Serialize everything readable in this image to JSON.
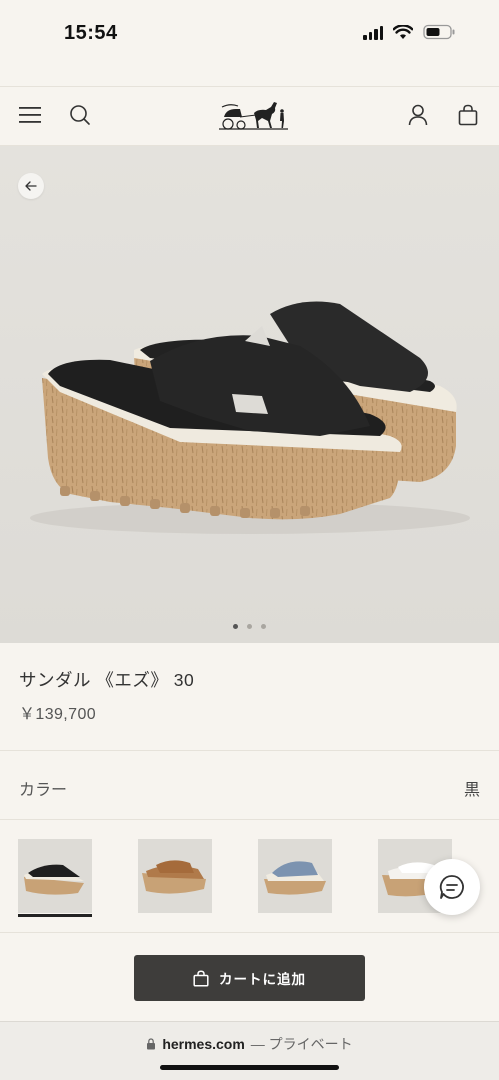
{
  "status_bar": {
    "time": "15:54"
  },
  "header": {
    "menu_icon": "hamburger-icon",
    "search_icon": "search-icon",
    "logo": "hermes-carriage-logo",
    "account_icon": "user-icon",
    "bag_icon": "shopping-bag-icon"
  },
  "gallery": {
    "image_count": 3,
    "active_index": 0
  },
  "product": {
    "name": "サンダル 《エズ》 30",
    "price": "￥139,700"
  },
  "color": {
    "label": "カラー",
    "value": "黒"
  },
  "variants": [
    {
      "name": "black",
      "selected": true
    },
    {
      "name": "brown",
      "selected": false
    },
    {
      "name": "blue",
      "selected": false
    },
    {
      "name": "white",
      "selected": false
    }
  ],
  "cart": {
    "label": "カートに追加"
  },
  "browser": {
    "domain": "hermes.com",
    "suffix": "— プライベート"
  }
}
